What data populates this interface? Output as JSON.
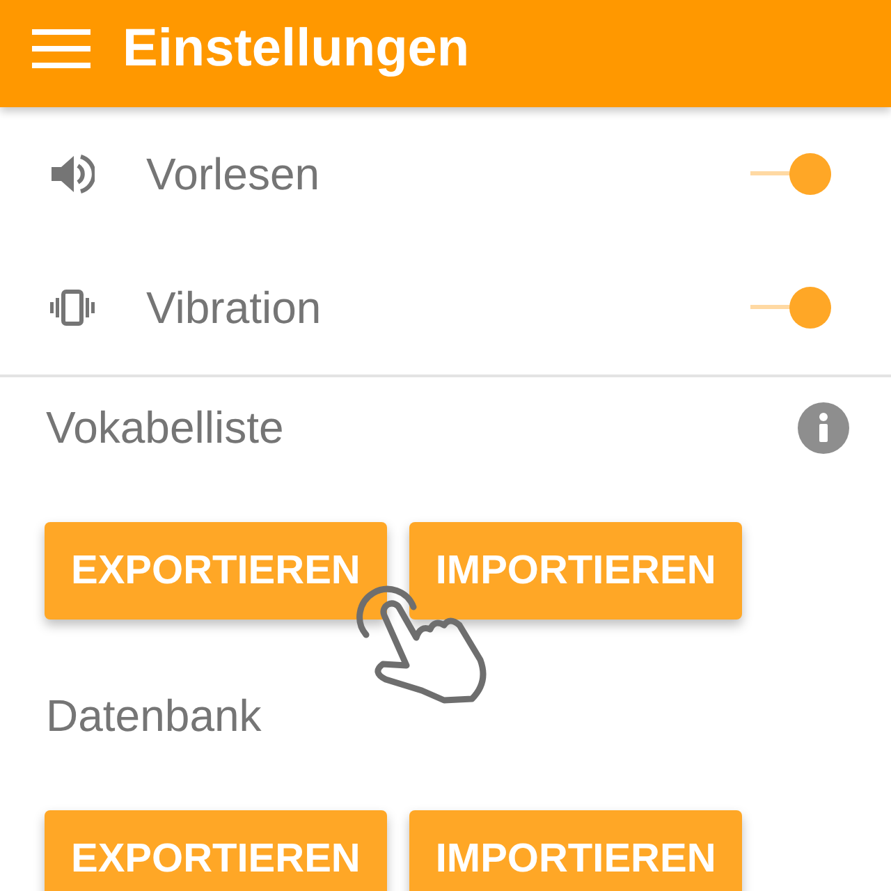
{
  "app_bar": {
    "title": "Einstellungen"
  },
  "toggles": [
    {
      "kind": "speaker",
      "label": "Vorlesen",
      "on": true
    },
    {
      "kind": "vibration",
      "label": "Vibration",
      "on": true
    }
  ],
  "sections": [
    {
      "title": "Vokabelliste",
      "info": true,
      "buttons": [
        {
          "label": "EXPORTIEREN",
          "tap_hint": true
        },
        {
          "label": "IMPORTIEREN",
          "tap_hint": false
        }
      ]
    },
    {
      "title": "Datenbank",
      "info": false,
      "buttons": [
        {
          "label": "EXPORTIEREN",
          "tap_hint": false
        },
        {
          "label": "IMPORTIEREN",
          "tap_hint": false
        }
      ]
    }
  ]
}
